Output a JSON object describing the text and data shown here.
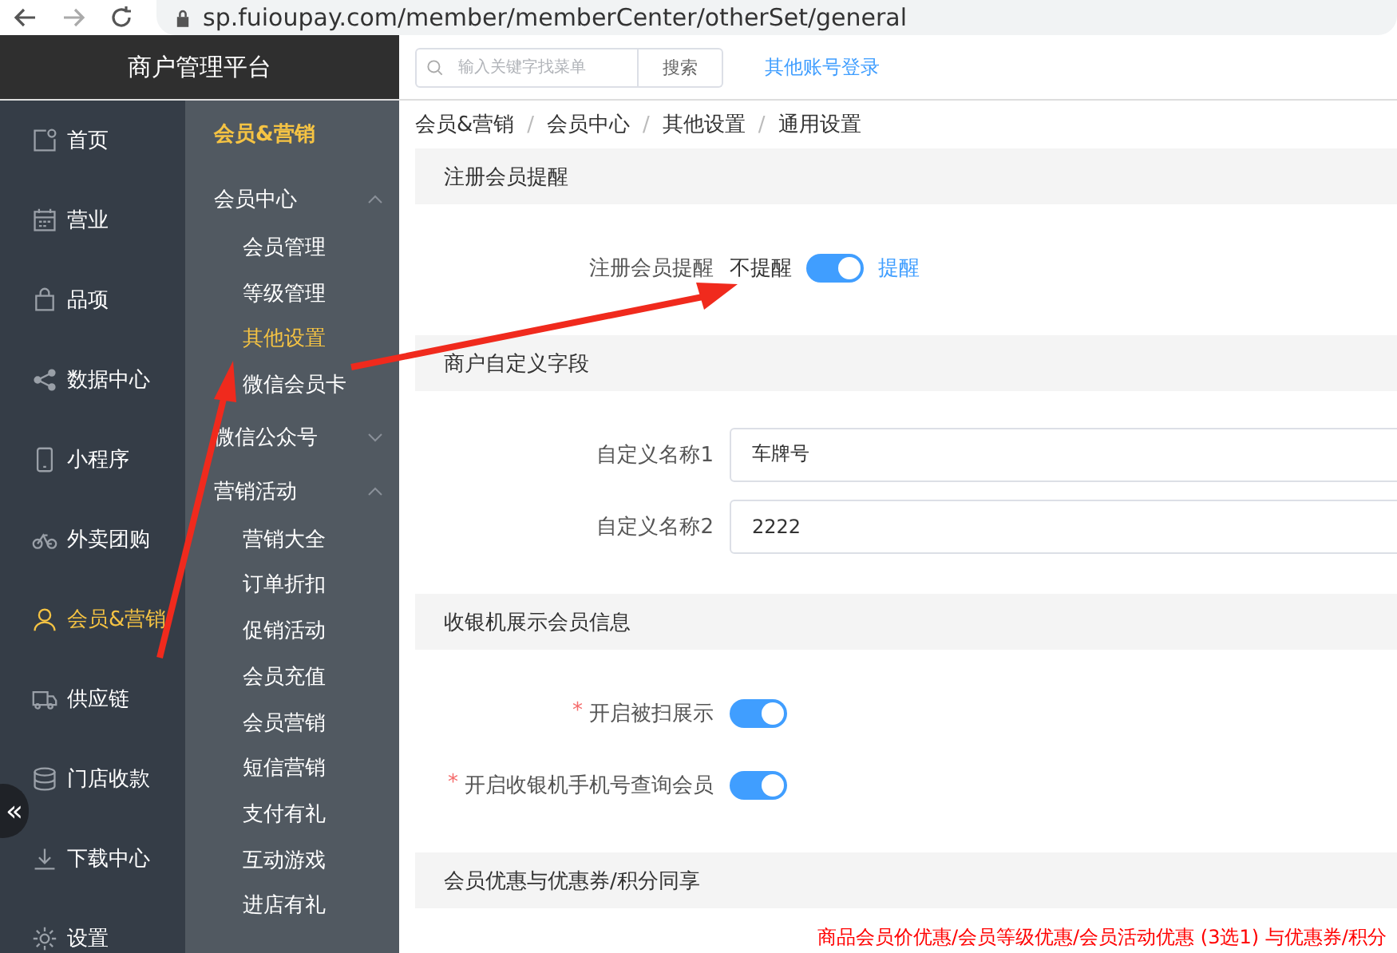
{
  "browser": {
    "url": "sp.fuioupay.com/member/memberCenter/otherSet/general"
  },
  "header": {
    "title": "商户管理平台",
    "search": {
      "placeholder": "输入关键字找菜单"
    },
    "search_button": "搜索",
    "link": "其他账号登录"
  },
  "nav": {
    "items": [
      {
        "label": "首页",
        "selected": false
      },
      {
        "label": "营业",
        "selected": false
      },
      {
        "label": "品项",
        "selected": false
      },
      {
        "label": "数据中心",
        "selected": false
      },
      {
        "label": "小程序",
        "selected": false
      },
      {
        "label": "外卖团购",
        "selected": false
      },
      {
        "label": "会员&营销",
        "selected": true
      },
      {
        "label": "供应链",
        "selected": false
      },
      {
        "label": "门店收款",
        "selected": false
      },
      {
        "label": "下载中心",
        "selected": false
      },
      {
        "label": "设置",
        "selected": false
      }
    ],
    "collapse": "«"
  },
  "submenu": {
    "title": "会员&营销",
    "groups": [
      {
        "label": "会员中心",
        "expanded": true,
        "children": [
          {
            "label": "会员管理",
            "selected": false
          },
          {
            "label": "等级管理",
            "selected": false
          },
          {
            "label": "其他设置",
            "selected": true
          },
          {
            "label": "微信会员卡",
            "selected": false
          }
        ]
      },
      {
        "label": "微信公众号",
        "expanded": false
      },
      {
        "label": "营销活动",
        "expanded": true,
        "children": [
          {
            "label": "营销大全",
            "selected": false
          },
          {
            "label": "订单折扣",
            "selected": false
          },
          {
            "label": "促销活动",
            "selected": false
          },
          {
            "label": "会员充值",
            "selected": false
          },
          {
            "label": "会员营销",
            "selected": false
          },
          {
            "label": "短信营销",
            "selected": false
          },
          {
            "label": "支付有礼",
            "selected": false
          },
          {
            "label": "互动游戏",
            "selected": false
          },
          {
            "label": "进店有礼",
            "selected": false
          }
        ]
      }
    ]
  },
  "breadcrumb": [
    "会员&营销",
    "会员中心",
    "其他设置",
    "通用设置"
  ],
  "breadcrumb_separator": "/",
  "sections": [
    {
      "title": "注册会员提醒",
      "fields": [
        {
          "kind": "switch",
          "label": "注册会员提醒",
          "off_label": "不提醒",
          "on_label": "提醒",
          "on": true
        }
      ]
    },
    {
      "title": "商户自定义字段",
      "fields": [
        {
          "kind": "input",
          "label": "自定义名称1",
          "value": "车牌号"
        },
        {
          "kind": "input",
          "label": "自定义名称2",
          "value": "2222"
        }
      ]
    },
    {
      "title": "收银机展示会员信息",
      "fields": [
        {
          "kind": "switch",
          "label": "开启被扫展示",
          "required_mark": "*",
          "on": true
        },
        {
          "kind": "switch",
          "label": "开启收银机手机号查询会员",
          "required_mark": "*",
          "on": true
        }
      ]
    },
    {
      "title": "会员优惠与优惠券/积分同享",
      "note": "商品会员价优惠/会员等级优惠/会员活动优惠 (3选1) 与优惠券/积分"
    }
  ]
}
